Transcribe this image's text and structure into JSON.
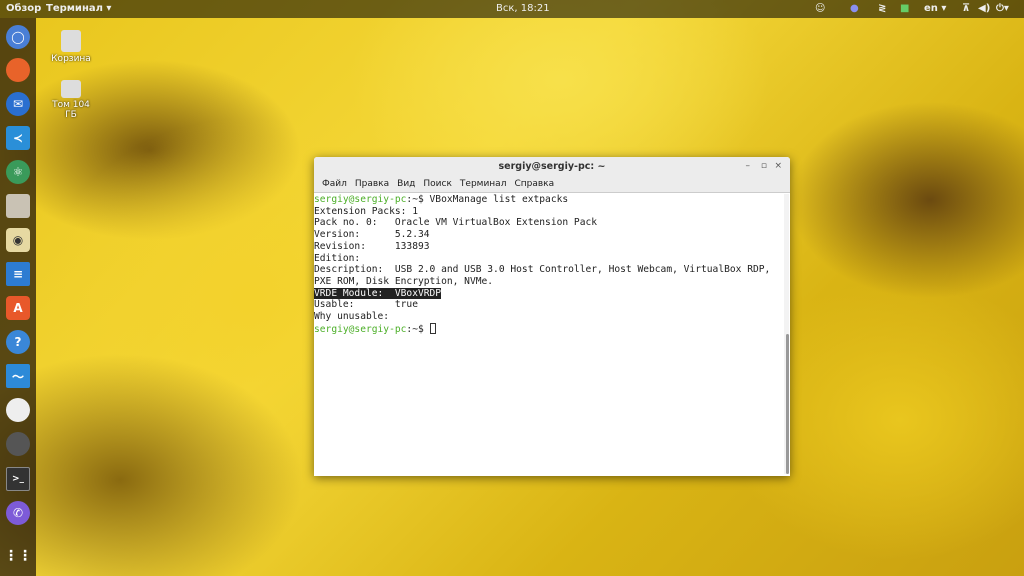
{
  "topbar": {
    "overview": "Обзор",
    "app_menu": "Терминал ▾",
    "clock": "Вск, 18:21",
    "lang": "en ▾"
  },
  "desktop": {
    "trash": "Корзина",
    "volume": "Том 104 ГБ"
  },
  "dock": [
    "chromium",
    "firefox",
    "thunderbird",
    "vscode",
    "atom",
    "files",
    "rhythmbox",
    "writer",
    "software",
    "help",
    "monitor",
    "eggs",
    "gimp",
    "terminal",
    "viber",
    "apps"
  ],
  "window": {
    "title": "sergiy@sergiy-pc: ~",
    "menu": [
      "Файл",
      "Правка",
      "Вид",
      "Поиск",
      "Терминал",
      "Справка"
    ],
    "prompt_user": "sergiy@sergiy-pc",
    "prompt_path": ":~$ ",
    "command": "VBoxManage list extpacks",
    "lines": [
      "Extension Packs: 1",
      "Pack no. 0:   Oracle VM VirtualBox Extension Pack",
      "Version:      5.2.34",
      "Revision:     133893",
      "Edition:",
      "Description:  USB 2.0 and USB 3.0 Host Controller, Host Webcam, VirtualBox RDP,",
      "PXE ROM, Disk Encryption, NVMe."
    ],
    "selected_line": "VRDE Module:  VBoxVRDP",
    "lines2": [
      "Usable:       true",
      "Why unusable:"
    ]
  }
}
